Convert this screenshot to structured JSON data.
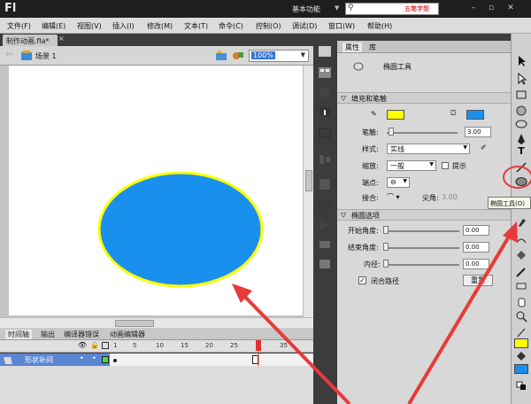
{
  "app": {
    "logo": "Fl",
    "workspace": "基本功能",
    "search_placeholder": "",
    "search_watermark": "五笔字型"
  },
  "menu": [
    "文件(F)",
    "编辑(E)",
    "视图(V)",
    "插入(I)",
    "修改(M)",
    "文本(T)",
    "命令(C)",
    "控制(O)",
    "调试(D)",
    "窗口(W)",
    "帮助(H)"
  ],
  "document": {
    "tab_title": "制作动画.fla*",
    "scene": "场景 1",
    "zoom": "100%"
  },
  "timeline": {
    "tabs": [
      "时间轴",
      "输出",
      "编译器错误",
      "动画编辑器"
    ],
    "frame_numbers": [
      "1",
      "5",
      "10",
      "15",
      "20",
      "25",
      "30",
      "35"
    ],
    "layer_name": "形状补间"
  },
  "properties": {
    "tabs": [
      "属性",
      "库"
    ],
    "tool_name": "椭圆工具",
    "fill_stroke_section": "填充和笔触",
    "stroke_label": "笔触:",
    "stroke_value": "3.00",
    "style_label": "样式:",
    "style_value": "实线",
    "scale_label": "缩放:",
    "scale_value": "一般",
    "hint_label": "提示",
    "cap_label": "端点:",
    "join_label": "接合:",
    "miter_label": "尖角:",
    "miter_value": "3.00",
    "ellipse_section": "椭圆选项",
    "start_angle_label": "开始角度:",
    "start_angle_value": "0.00",
    "end_angle_label": "结束角度:",
    "end_angle_value": "0.00",
    "inner_radius_label": "内径:",
    "inner_radius_value": "0.00",
    "close_path_label": "闭合路径",
    "reset_label": "重置"
  },
  "tooltip": "椭圆工具(O)",
  "colors": {
    "stroke": "#ffff00",
    "fill": "#1a90ee",
    "accent": "#3875d7"
  }
}
